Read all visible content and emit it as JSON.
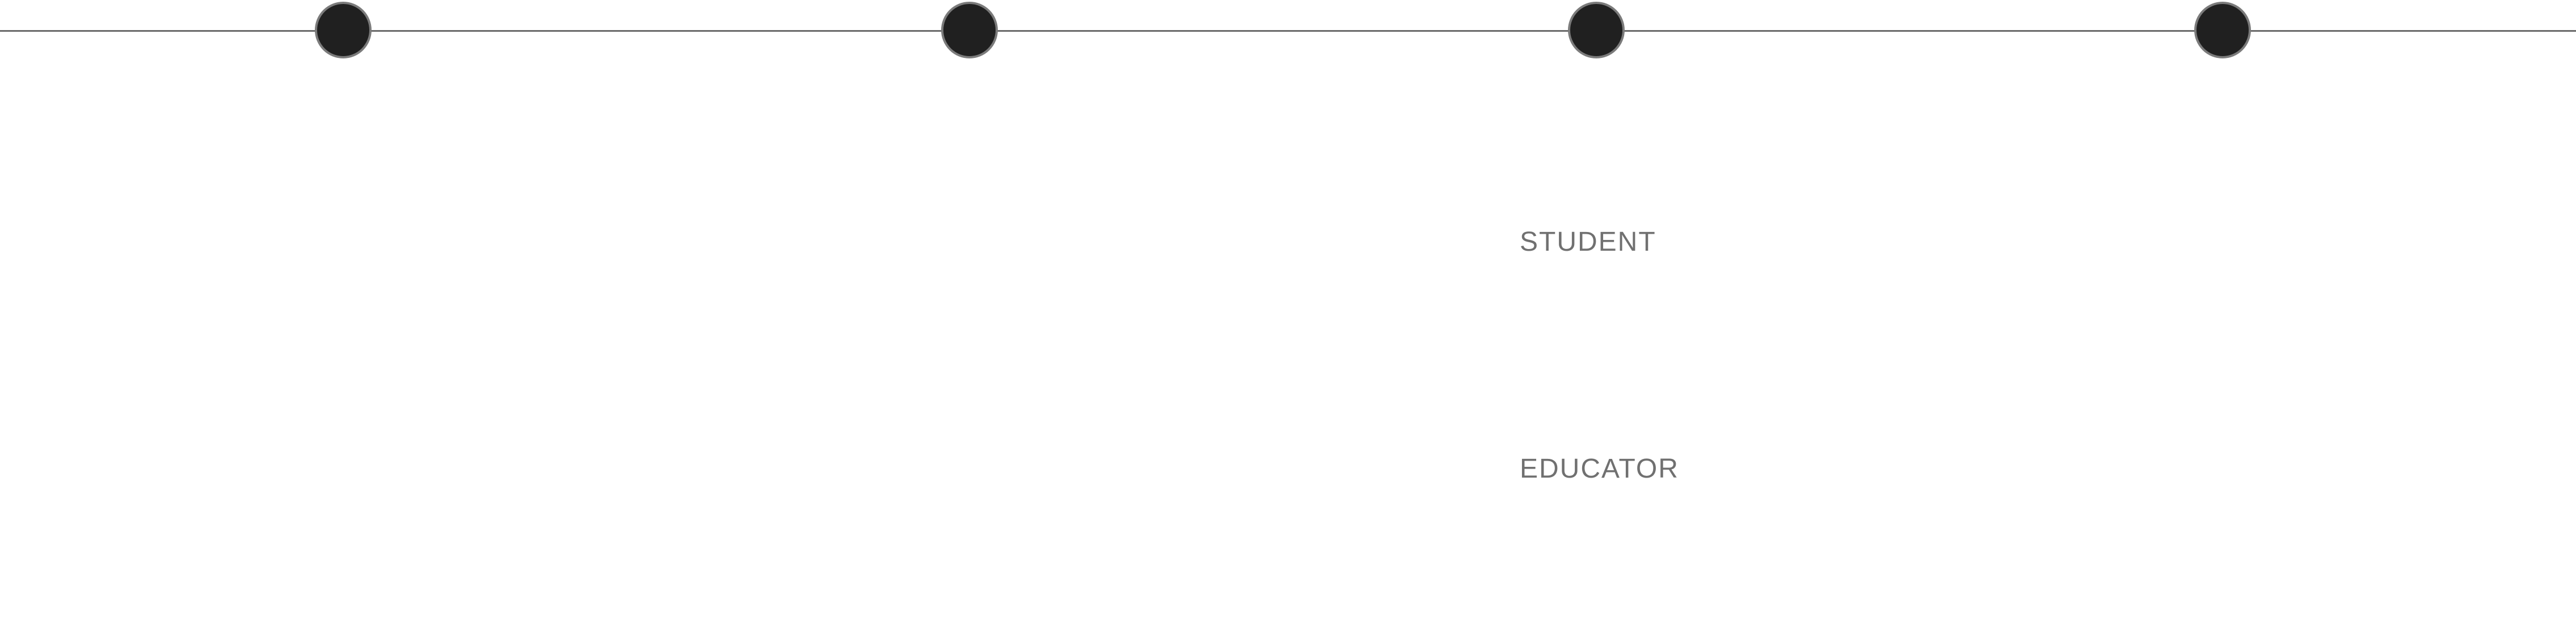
{
  "timeline": {
    "nodes": [
      {
        "id": "node-1"
      },
      {
        "id": "node-2"
      },
      {
        "id": "node-3"
      },
      {
        "id": "node-4"
      }
    ],
    "colors": {
      "line": "#6a6a6a",
      "node_fill": "#202020",
      "node_border": "#7b7b7b"
    }
  },
  "roles": {
    "student": "STUDENT",
    "educator": "EDUCATOR"
  },
  "colors": {
    "label_text": "#707070",
    "background": "#ffffff"
  }
}
